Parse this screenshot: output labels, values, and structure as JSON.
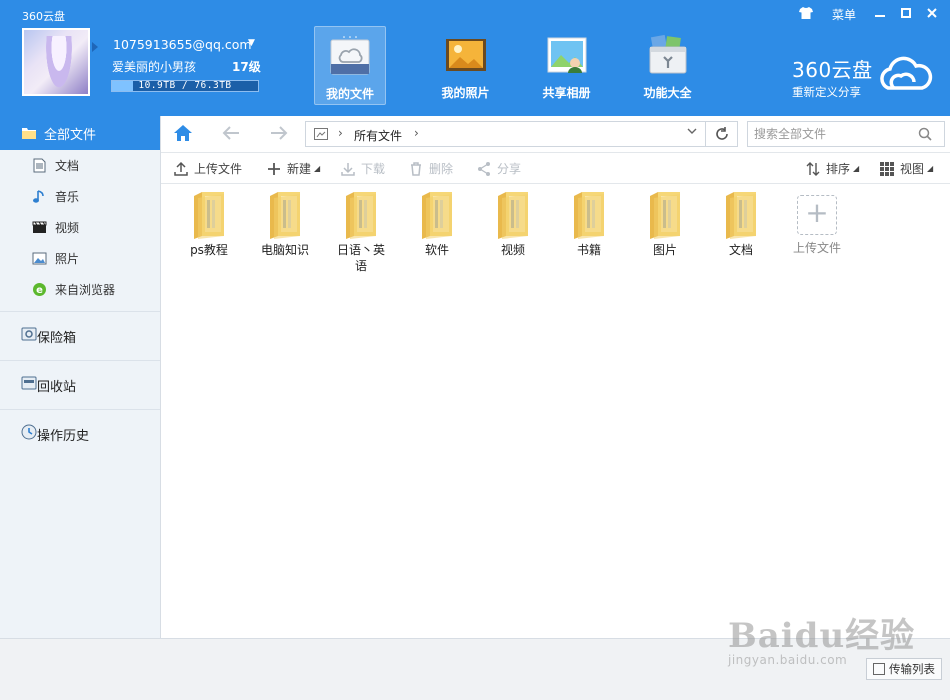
{
  "app": {
    "title": "360云盘"
  },
  "window": {
    "skin_label": "菜单"
  },
  "user": {
    "email": "1075913655@qq.com",
    "nickname": "爱美丽的小男孩",
    "level": "17级",
    "storage_text": "10.9TB / 76.3TB",
    "storage_used_fraction": 0.143
  },
  "nav_tabs": [
    {
      "label": "我的文件",
      "icon": "cloud-folder-icon",
      "active": true
    },
    {
      "label": "我的照片",
      "icon": "photo-album-icon",
      "active": false
    },
    {
      "label": "共享相册",
      "icon": "shared-album-icon",
      "active": false
    },
    {
      "label": "功能大全",
      "icon": "toolbox-icon",
      "active": false
    }
  ],
  "brand": {
    "name": "360云盘",
    "slogan": "重新定义分享"
  },
  "sidebar": {
    "all_files": "全部文件",
    "sub_items": [
      {
        "label": "文档",
        "icon": "document-icon"
      },
      {
        "label": "音乐",
        "icon": "music-note-icon"
      },
      {
        "label": "视频",
        "icon": "film-icon"
      },
      {
        "label": "照片",
        "icon": "picture-icon"
      },
      {
        "label": "来自浏览器",
        "icon": "browser-e-icon"
      }
    ],
    "vault": "保险箱",
    "recycle": "回收站",
    "history": "操作历史"
  },
  "address": {
    "path": "所有文件",
    "search_placeholder": "搜索全部文件"
  },
  "toolbar": {
    "upload": "上传文件",
    "new": "新建",
    "download": "下载",
    "delete": "删除",
    "share": "分享",
    "sort": "排序",
    "view": "视图"
  },
  "files": [
    {
      "name": "ps教程"
    },
    {
      "name": "电脑知识"
    },
    {
      "name": "日语丶英语"
    },
    {
      "name": "软件"
    },
    {
      "name": "视频"
    },
    {
      "name": "书籍"
    },
    {
      "name": "图片"
    },
    {
      "name": "文档"
    }
  ],
  "upload_tile": {
    "label": "上传文件"
  },
  "footer": {
    "transfer_list": "传输列表"
  },
  "watermark": {
    "main": "Baidu经验",
    "sub": "jingyan.baidu.com"
  },
  "colors": {
    "accent": "#2e8ce6",
    "sidebar_bg": "#eef3f8",
    "folder": "#f3cf6b"
  }
}
